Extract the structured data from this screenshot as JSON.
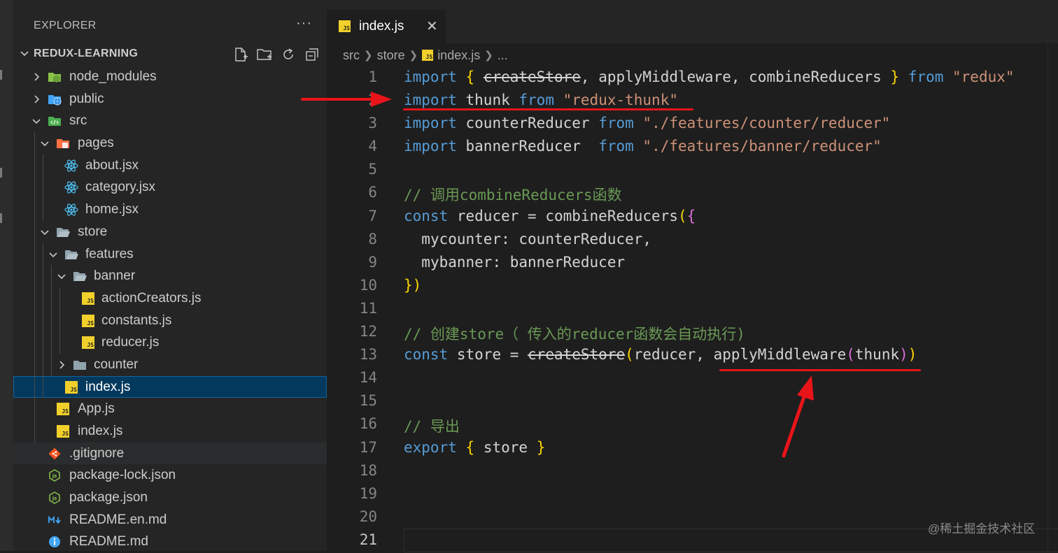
{
  "explorer": {
    "title": "EXPLORER",
    "more": "···",
    "project": "REDUX-LEARNING",
    "actions": [
      "new-file-icon",
      "new-folder-icon",
      "refresh-icon",
      "collapse-all-icon"
    ]
  },
  "tree": [
    {
      "label": "node_modules",
      "icon": "node-modules-folder-icon",
      "type": "folder",
      "expanded": false
    },
    {
      "label": "public",
      "icon": "public-folder-icon",
      "type": "folder",
      "expanded": false
    },
    {
      "label": "src",
      "icon": "src-folder-icon",
      "type": "folder",
      "expanded": true
    },
    {
      "label": "pages",
      "icon": "pages-folder-icon",
      "type": "folder",
      "expanded": true
    },
    {
      "label": "about.jsx",
      "icon": "react-icon",
      "type": "file"
    },
    {
      "label": "category.jsx",
      "icon": "react-icon",
      "type": "file"
    },
    {
      "label": "home.jsx",
      "icon": "react-icon",
      "type": "file"
    },
    {
      "label": "store",
      "icon": "folder-open-icon",
      "type": "folder",
      "expanded": true
    },
    {
      "label": "features",
      "icon": "folder-open-icon",
      "type": "folder",
      "expanded": true
    },
    {
      "label": "banner",
      "icon": "folder-open-icon",
      "type": "folder",
      "expanded": true
    },
    {
      "label": "actionCreators.js",
      "icon": "js-icon",
      "type": "file"
    },
    {
      "label": "constants.js",
      "icon": "js-icon",
      "type": "file"
    },
    {
      "label": "reducer.js",
      "icon": "js-icon",
      "type": "file"
    },
    {
      "label": "counter",
      "icon": "folder-icon",
      "type": "folder",
      "expanded": false
    },
    {
      "label": "index.js",
      "icon": "js-icon",
      "type": "file",
      "selected": true
    },
    {
      "label": "App.js",
      "icon": "js-icon",
      "type": "file"
    },
    {
      "label": "index.js",
      "icon": "js-icon",
      "type": "file"
    },
    {
      "label": ".gitignore",
      "icon": "git-icon",
      "type": "file",
      "hovered": true
    },
    {
      "label": "package-lock.json",
      "icon": "nodejs-icon",
      "type": "file"
    },
    {
      "label": "package.json",
      "icon": "nodejs-icon",
      "type": "file"
    },
    {
      "label": "README.en.md",
      "icon": "markdown-icon",
      "type": "file"
    },
    {
      "label": "README.md",
      "icon": "info-icon",
      "type": "file"
    }
  ],
  "tab": {
    "label": "index.js",
    "close": "✕",
    "icon": "JS"
  },
  "breadcrumb": [
    "src",
    "store",
    "index.js",
    "..."
  ],
  "code": {
    "active_line": 21,
    "lines": [
      "import { createStore, applyMiddleware, combineReducers } from \"redux\"",
      "import thunk from \"redux-thunk\"",
      "import counterReducer from \"./features/counter/reducer\"",
      "import bannerReducer  from \"./features/banner/reducer\"",
      "",
      "// 调用combineReducers函数",
      "const reducer = combineReducers({",
      "  mycounter: counterReducer,",
      "  mybanner: bannerReducer",
      "})",
      "",
      "// 创建store（ 传入的reducer函数会自动执行)",
      "const store = createStore(reducer, applyMiddleware(thunk))",
      "",
      "",
      "// 导出",
      "export { store }",
      "",
      "",
      "",
      ""
    ]
  },
  "watermark": "@稀土掘金技术社区",
  "colors": {
    "annotation": "#e8141a",
    "selection": "#04395e",
    "keyword": "#569cd6",
    "string": "#ce9178",
    "comment": "#6a9955"
  }
}
